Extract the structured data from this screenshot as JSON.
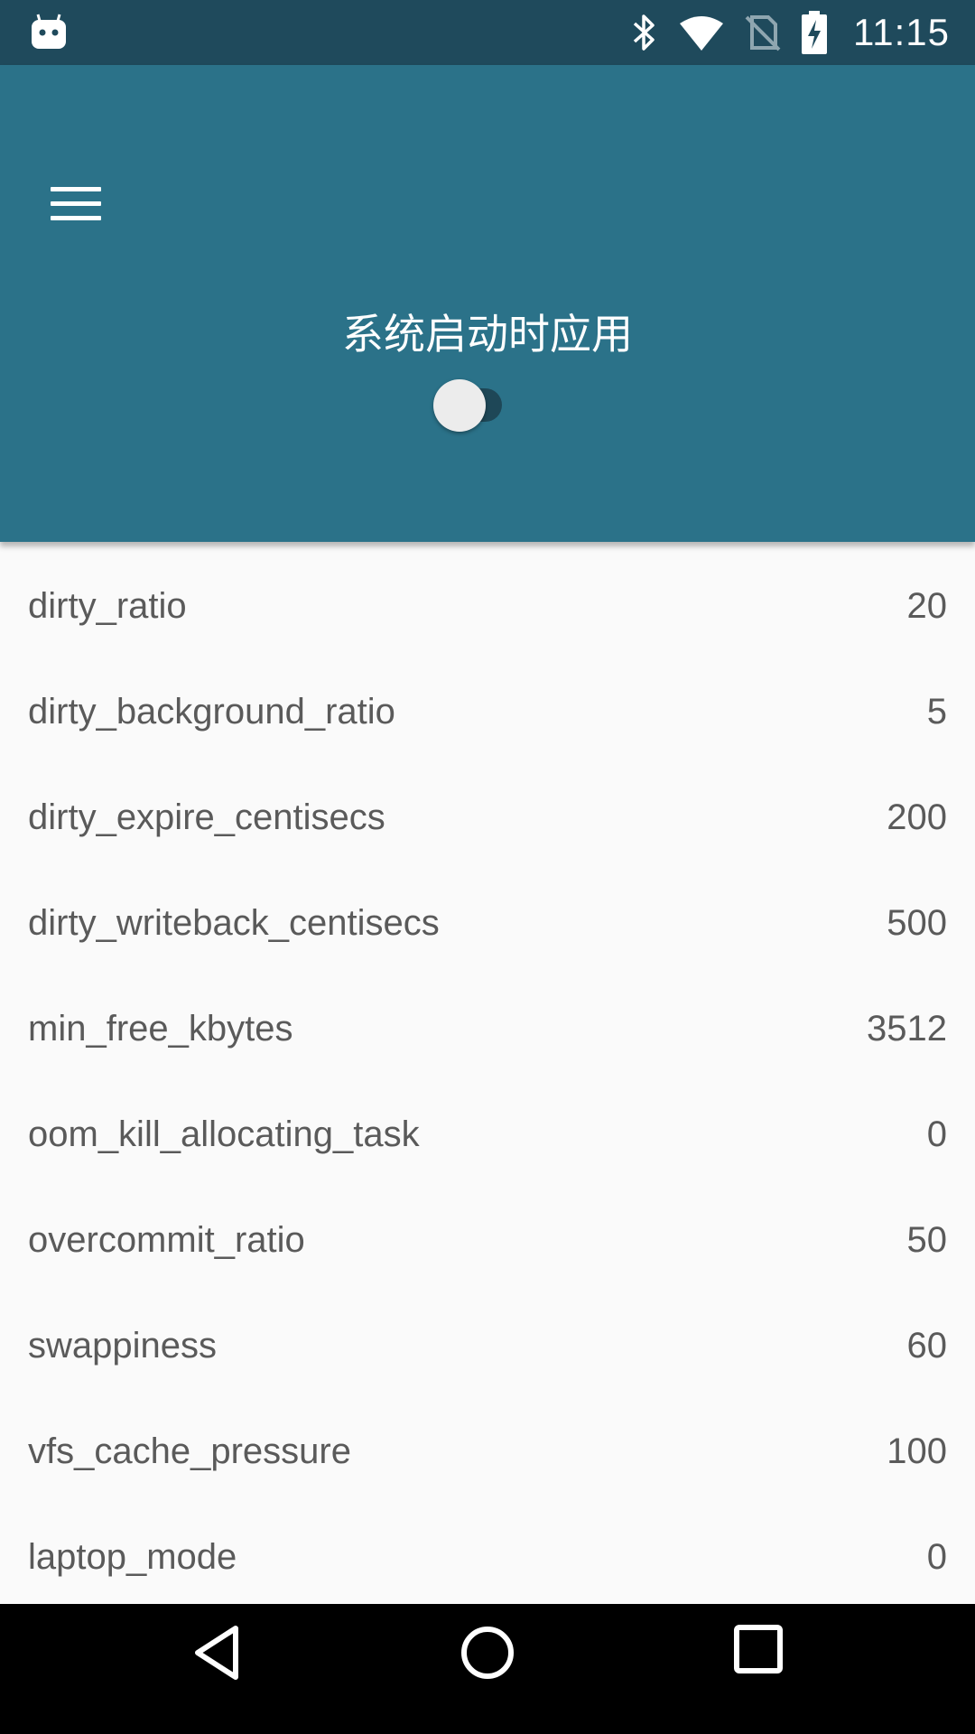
{
  "status_bar": {
    "time": "11:15",
    "icons": [
      "android-app-icon",
      "bluetooth-icon",
      "wifi-icon",
      "no-sim-icon",
      "battery-charging-icon"
    ]
  },
  "header": {
    "title": "系统启动时应用",
    "toggle_on": false,
    "background": "#2b7289"
  },
  "params": [
    {
      "key": "dirty_ratio",
      "value": "20"
    },
    {
      "key": "dirty_background_ratio",
      "value": "5"
    },
    {
      "key": "dirty_expire_centisecs",
      "value": "200"
    },
    {
      "key": "dirty_writeback_centisecs",
      "value": "500"
    },
    {
      "key": "min_free_kbytes",
      "value": "3512"
    },
    {
      "key": "oom_kill_allocating_task",
      "value": "0"
    },
    {
      "key": "overcommit_ratio",
      "value": "50"
    },
    {
      "key": "swappiness",
      "value": "60"
    },
    {
      "key": "vfs_cache_pressure",
      "value": "100"
    },
    {
      "key": "laptop_mode",
      "value": "0"
    }
  ],
  "nav_bar": {
    "icons": [
      "back-icon",
      "home-icon",
      "recents-icon"
    ]
  }
}
